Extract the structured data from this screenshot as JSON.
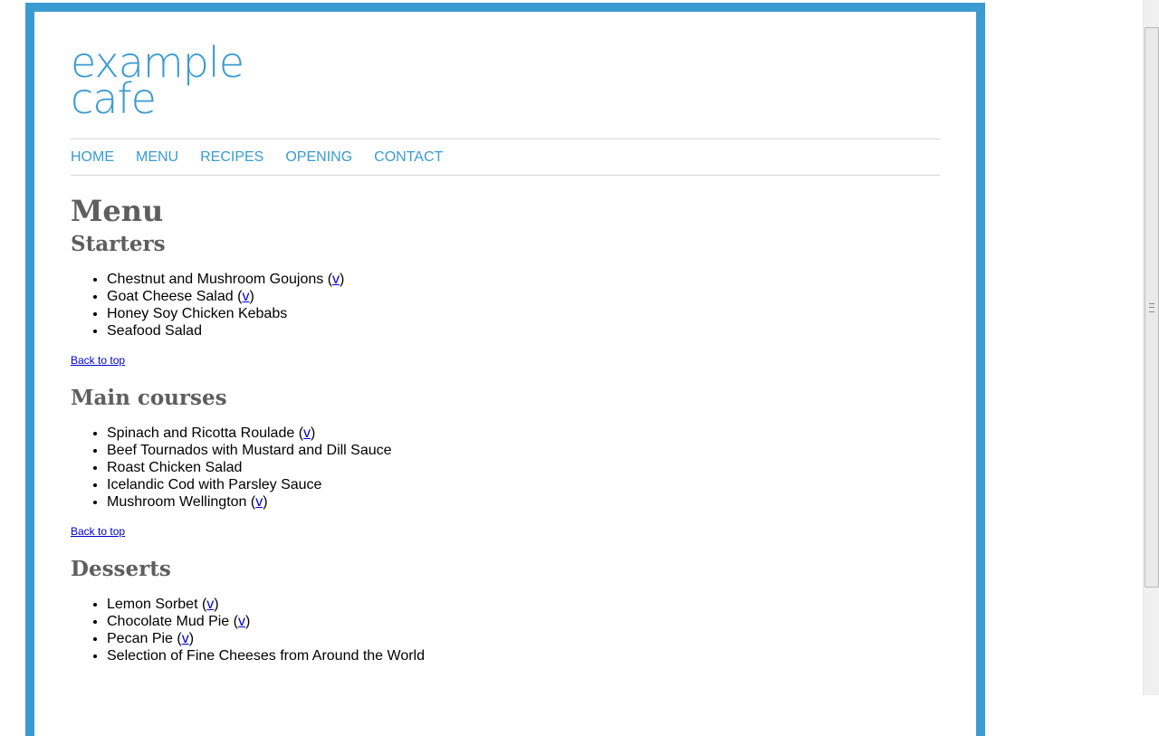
{
  "logo": {
    "line1": "example",
    "line2": "cafe"
  },
  "nav": [
    "HOME",
    "MENU",
    "RECIPES",
    "OPENING",
    "CONTACT"
  ],
  "page_title": "Menu",
  "sections": [
    {
      "title": "Starters",
      "items": [
        {
          "name": "Chestnut and Mushroom Goujons",
          "v": true
        },
        {
          "name": "Goat Cheese Salad",
          "v": true
        },
        {
          "name": "Honey Soy Chicken Kebabs",
          "v": false
        },
        {
          "name": "Seafood Salad",
          "v": false
        }
      ]
    },
    {
      "title": "Main courses",
      "items": [
        {
          "name": "Spinach and Ricotta Roulade",
          "v": true
        },
        {
          "name": "Beef Tournados with Mustard and Dill Sauce",
          "v": false
        },
        {
          "name": "Roast Chicken Salad",
          "v": false
        },
        {
          "name": "Icelandic Cod with Parsley Sauce",
          "v": false
        },
        {
          "name": "Mushroom Wellington",
          "v": true
        }
      ]
    },
    {
      "title": "Desserts",
      "items": [
        {
          "name": "Lemon Sorbet",
          "v": true
        },
        {
          "name": "Chocolate Mud Pie",
          "v": true
        },
        {
          "name": "Pecan Pie",
          "v": true
        },
        {
          "name": "Selection of Fine Cheeses from Around the World",
          "v": false
        }
      ]
    }
  ],
  "back_to_top": "Back to top",
  "v_label": "v",
  "colors": {
    "accent": "#3a9bd1",
    "heading": "#5e5e5e",
    "link": "#0000cc"
  }
}
